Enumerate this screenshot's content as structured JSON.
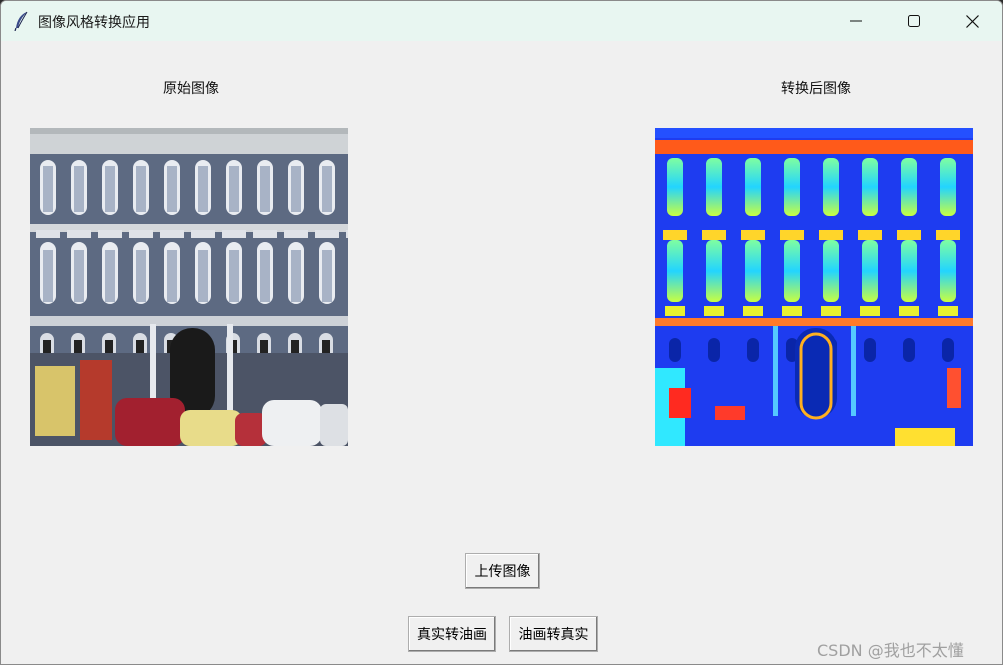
{
  "window": {
    "title": "图像风格转换应用",
    "icons": {
      "app": "feather-icon",
      "minimize": "minimize-icon",
      "maximize": "maximize-icon",
      "close": "close-icon"
    }
  },
  "panels": {
    "original_label": "原始图像",
    "converted_label": "转换后图像"
  },
  "buttons": {
    "upload": "上传图像",
    "real_to_oil": "真实转油画",
    "oil_to_real": "油画转真实"
  },
  "watermark": "CSDN @我也不太懂",
  "colors": {
    "titlebar": "#e8f6f1",
    "background": "#f0f0f0"
  }
}
